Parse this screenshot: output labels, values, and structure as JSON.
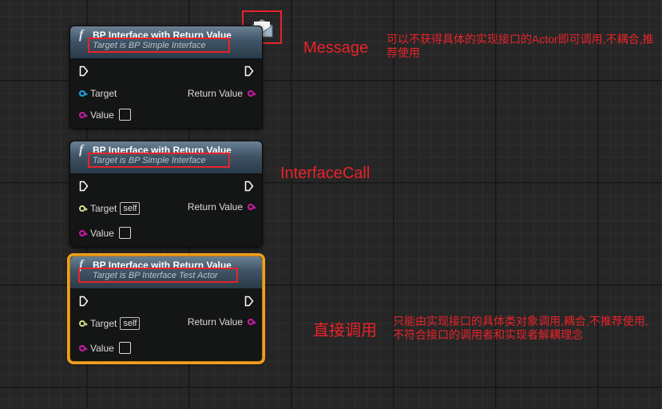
{
  "nodes": [
    {
      "title": "BP Interface with Return Value",
      "subtitle": "Target is BP Simple Interface",
      "target_label": "Target",
      "target_default": "",
      "value_label": "Value",
      "return_label": "Return Value"
    },
    {
      "title": "BP Interface with Return Value",
      "subtitle": "Target is BP Simple Interface",
      "target_label": "Target",
      "target_default": "self",
      "value_label": "Value",
      "return_label": "Return Value"
    },
    {
      "title": "BP Interface with Return Value",
      "subtitle": "Target is BP Interface Test Actor",
      "target_label": "Target",
      "target_default": "self",
      "value_label": "Value",
      "return_label": "Return Value"
    }
  ],
  "annotations": {
    "message_label": "Message",
    "message_note": "可以不获得具体的实现接口的Actor即可调用,不耦合,推荐使用",
    "interface_call_label": "InterfaceCall",
    "direct_call_label": "直接调用",
    "direct_call_note": "只能由实现接口的具体类对象调用,耦合,不推荐使用,不符合接口的调用者和实现者解耦理念"
  },
  "colors": {
    "exec_pin": "#ffffff",
    "object_pin": "#1aa7e8",
    "interface_pin": "#d8dc8e",
    "bool_pin": "#ce1aa8",
    "selection": "#f0a01e",
    "annotation": "#e8232a"
  },
  "icons": {
    "function": "function-f-icon",
    "message": "envelope-icon"
  }
}
